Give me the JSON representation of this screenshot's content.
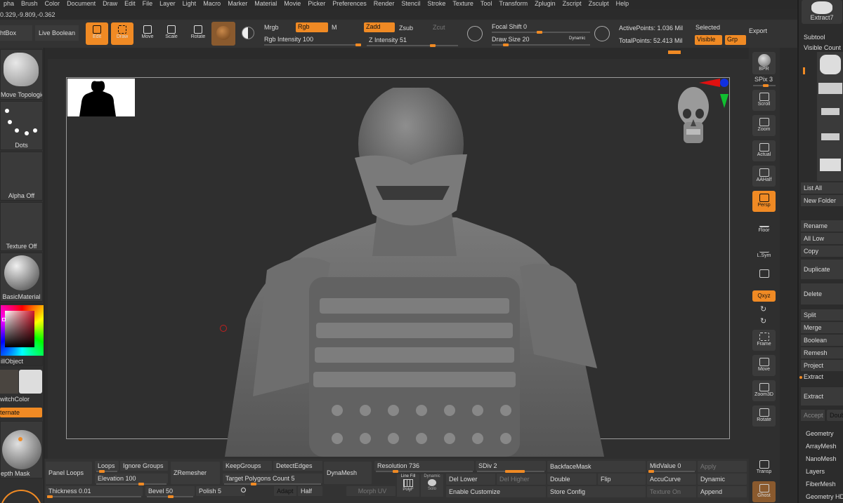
{
  "menu": [
    "pha",
    "Brush",
    "Color",
    "Document",
    "Draw",
    "Edit",
    "File",
    "Layer",
    "Light",
    "Macro",
    "Marker",
    "Material",
    "Movie",
    "Picker",
    "Preferences",
    "Render",
    "Stencil",
    "Stroke",
    "Texture",
    "Tool",
    "Transform",
    "Zplugin",
    "Zscript",
    "Zsculpt",
    "Help"
  ],
  "coords": "0.329,-9.809,-0.362",
  "top": {
    "lightbox": "htBox",
    "live_boolean": "Live Boolean",
    "edit": "Edit",
    "draw": "Draw",
    "move": "Move",
    "scale": "Scale",
    "rotate": "Rotate",
    "mrgb": "Mrgb",
    "rgb": "Rgb",
    "m": "M",
    "rgb_intensity": "Rgb Intensity 100",
    "zadd": "Zadd",
    "zsub": "Zsub",
    "zcut": "Zcut",
    "z_intensity": "Z Intensity 51",
    "focal_shift": "Focal Shift 0",
    "draw_size": "Draw Size 20",
    "dynamic": "Dynamic",
    "active_points": "ActivePoints: 1.036 Mil",
    "total_points": "TotalPoints: 52.413 Mil",
    "selected": "Selected",
    "visible": "Visible",
    "grp": "Grp",
    "export": "Export"
  },
  "left": {
    "brush": "Move Topologica",
    "stroke": "Dots",
    "alpha": "Alpha Off",
    "texture": "Texture Off",
    "material": "BasicMaterial",
    "fill": "illObject",
    "switch": "witchColor",
    "alternate": "ternate",
    "depth": "epth Mask"
  },
  "right_shelf": {
    "bpr": "BPR",
    "spix": "SPix 3",
    "scroll": "Scroll",
    "zoom": "Zoom",
    "actual": "Actual",
    "aahalf": "AAHalf",
    "persp": "Persp",
    "floor": "Floor",
    "lsym": "L.Sym",
    "xyz": "Qxyz",
    "frame": "Frame",
    "move": "Move",
    "zoom3d": "Zoom3D",
    "rotate": "Rotate",
    "transp": "Transp",
    "ghost": "Ghost"
  },
  "tray": {
    "extract": "Extract7",
    "subtool": "Subtool",
    "visible_count": "Visible Count",
    "list_all": "List All",
    "new_folder": "New Folder",
    "rename": "Rename",
    "all_low": "All Low",
    "copy": "Copy",
    "duplicate": "Duplicate",
    "delete": "Delete",
    "split": "Split",
    "merge": "Merge",
    "boolean": "Boolean",
    "remesh": "Remesh",
    "project": "Project",
    "extract_label": "Extract",
    "extract_btn": "Extract",
    "accept": "Accept",
    "double": "Doub",
    "geometry": "Geometry",
    "arraymesh": "ArrayMesh",
    "nanomesh": "NanoMesh",
    "layers": "Layers",
    "fibermesh": "FiberMesh",
    "geometry_hd": "Geometry HD"
  },
  "bottom": {
    "panel_loops": "Panel Loops",
    "loops": "Loops",
    "ignore_groups": "Ignore Groups",
    "elevation": "Elevation 100",
    "thickness": "Thickness 0.01",
    "bevel": "Bevel 50",
    "polish": "Polish 5",
    "zremesher": "ZRemesher",
    "keepgroups": "KeepGroups",
    "detectedges": "DetectEdges",
    "target_polygons": "Target Polygons Count 5",
    "adapt": "Adapt",
    "half": "Half",
    "dynamesh": "DynaMesh",
    "resolution": "Resolution 736",
    "sdiv": "SDiv 2",
    "morph_uv": "Morph UV",
    "line_fill": "Line Fill",
    "polyf": "PolyF",
    "dynamic": "Dynamic",
    "solo": "Solo",
    "del_lower": "Del Lower",
    "del_higher": "Del Higher",
    "enable_customize": "Enable Customize",
    "backfacemask": "BackfaceMask",
    "double": "Double",
    "flip": "Flip",
    "store_config": "Store Config",
    "midvalue": "MidValue 0",
    "apply": "Apply",
    "accucurve": "AccuCurve",
    "dynamic2": "Dynamic",
    "texture_on": "Texture On",
    "append": "Append"
  },
  "colors": {
    "accent": "#f08a24",
    "bg": "#2b2b2b",
    "panel": "#333333"
  }
}
